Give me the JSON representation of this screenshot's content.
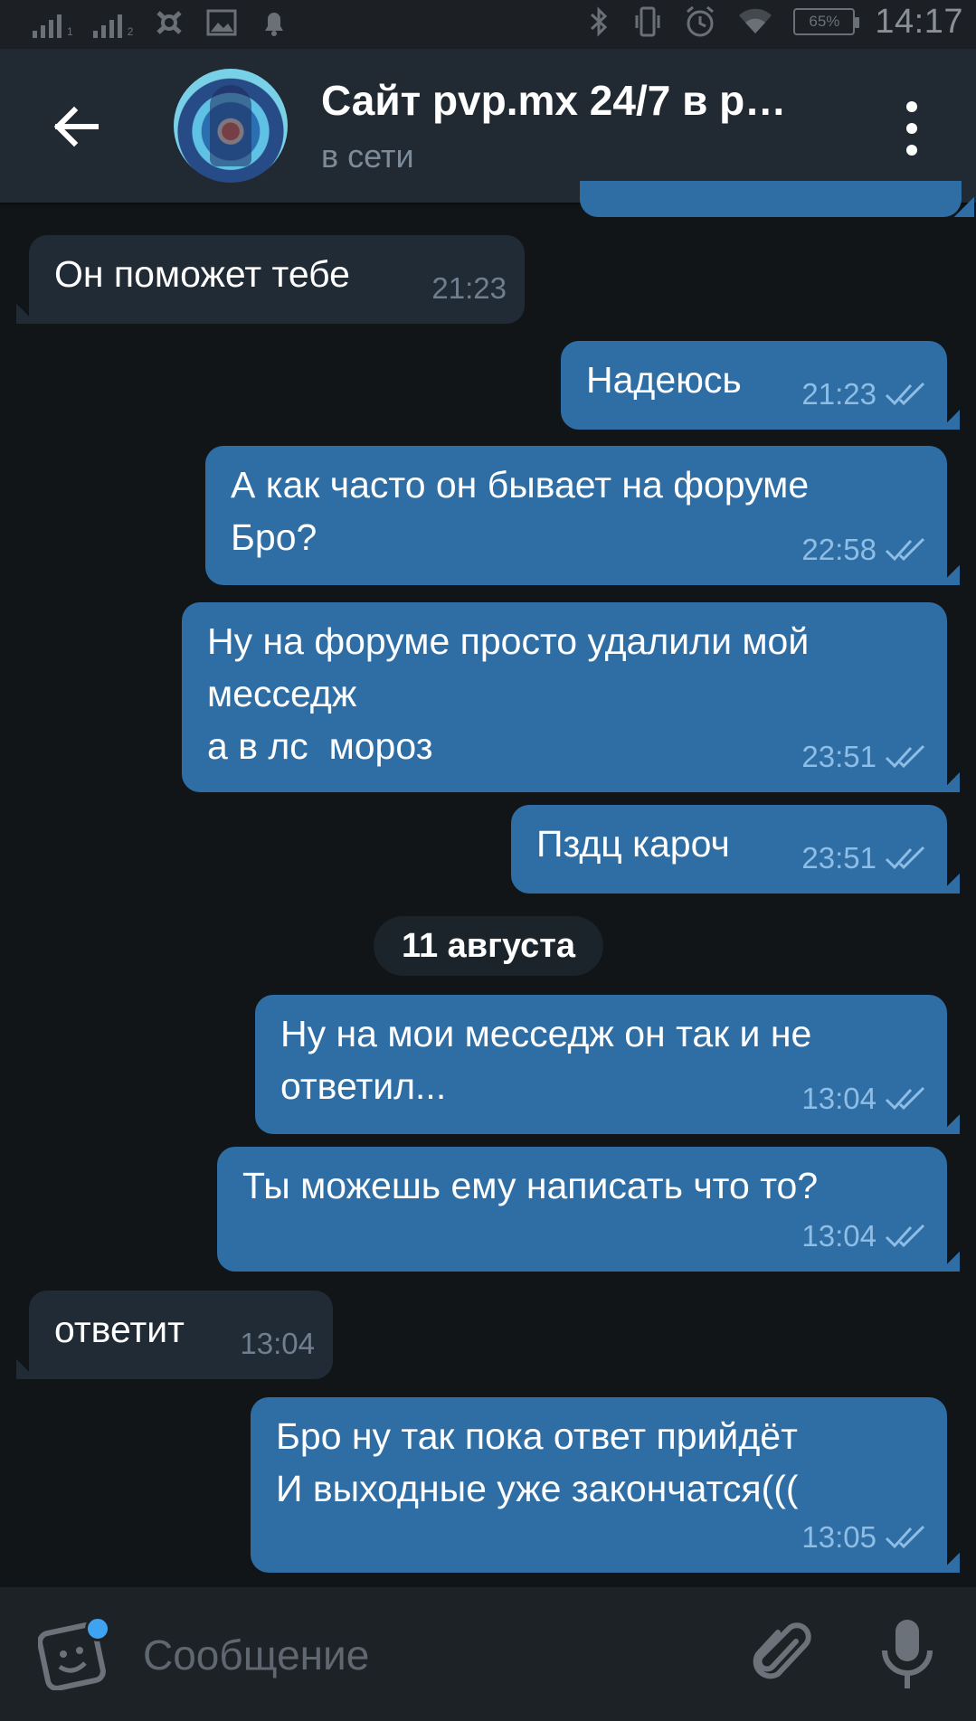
{
  "status_bar": {
    "battery": "65%",
    "time": "14:17",
    "sim1": "1",
    "sim2": "2"
  },
  "header": {
    "title": "Сайт pvp.mx 24/7 в р…",
    "status": "в сети"
  },
  "messages": [
    {
      "text": "Он поможет тебе",
      "time": "21:23",
      "dir": "in"
    },
    {
      "text": "Надеюсь",
      "time": "21:23",
      "dir": "out"
    },
    {
      "text": "А как часто он бывает на форуме\nБро?",
      "time": "22:58",
      "dir": "out"
    },
    {
      "text": "Ну на форуме просто удалили мой\nмесседж\nа в лс  мороз",
      "time": "23:51",
      "dir": "out"
    },
    {
      "text": "Пздц кароч",
      "time": "23:51",
      "dir": "out"
    },
    {
      "text": "Ну на мои месседж он так и не\nответил...",
      "time": "13:04",
      "dir": "out"
    },
    {
      "text": "Ты можешь ему написать что то?",
      "time": "13:04",
      "dir": "out"
    },
    {
      "text": "ответит",
      "time": "13:04",
      "dir": "in"
    },
    {
      "text": "Бро ну так пока ответ прийдёт\nИ выходные уже закончатся(((",
      "time": "13:05",
      "dir": "out"
    }
  ],
  "date_separator": "11 августа",
  "composer": {
    "placeholder": "Сообщение"
  },
  "icons": [
    "back-arrow-icon",
    "more-vert-icon",
    "read-ticks-icon",
    "sticker-icon",
    "attach-icon",
    "mic-icon"
  ],
  "colors": {
    "header_bg": "#212a33",
    "chat_bg": "#111518",
    "outgoing_bubble": "#2f6ea5",
    "incoming_bubble": "#212b35",
    "badge_dot": "#3ea4f1"
  }
}
